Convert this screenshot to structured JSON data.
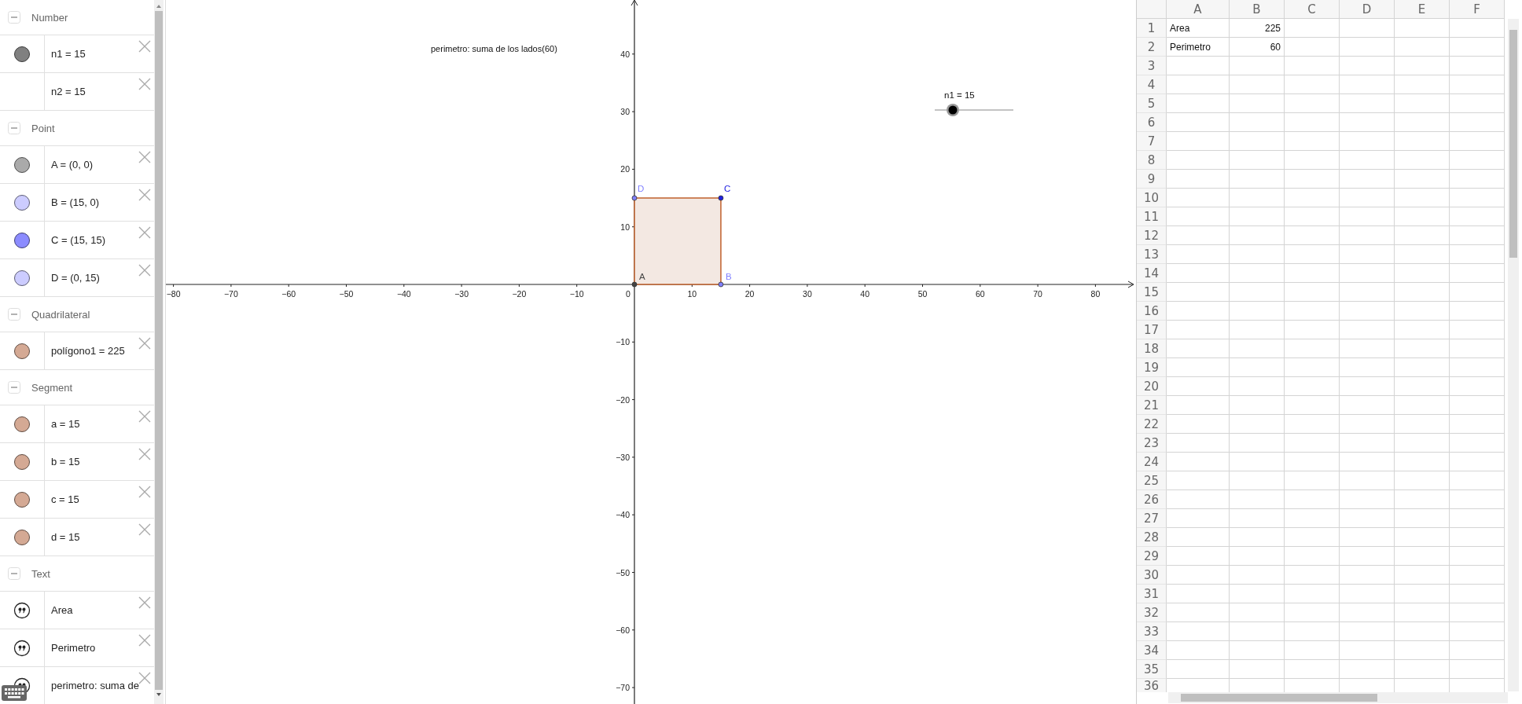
{
  "algebra": {
    "groups": [
      {
        "title": "Number",
        "expanded": true,
        "items": [
          {
            "kind": "dot",
            "color": "#808080",
            "text": "n1 = 15"
          },
          {
            "kind": "blank",
            "text": "n2 = 15"
          }
        ]
      },
      {
        "title": "Point",
        "expanded": true,
        "items": [
          {
            "kind": "dot",
            "color": "#aaaaaa",
            "text": "A = (0, 0)"
          },
          {
            "kind": "dot",
            "color": "#ccccff",
            "text": "B = (15, 0)"
          },
          {
            "kind": "dot",
            "color": "#8c8cff",
            "text": "C = (15, 15)"
          },
          {
            "kind": "dot",
            "color": "#ccccff",
            "text": "D = (0, 15)"
          }
        ]
      },
      {
        "title": "Quadrilateral",
        "expanded": true,
        "items": [
          {
            "kind": "dot",
            "color": "#d4a994",
            "text": "polígono1 = 225"
          }
        ]
      },
      {
        "title": "Segment",
        "expanded": true,
        "items": [
          {
            "kind": "dot",
            "color": "#d4a994",
            "text": "a = 15"
          },
          {
            "kind": "dot",
            "color": "#d4a994",
            "text": "b = 15"
          },
          {
            "kind": "dot",
            "color": "#d4a994",
            "text": "c = 15"
          },
          {
            "kind": "dot",
            "color": "#d4a994",
            "text": "d = 15"
          }
        ]
      },
      {
        "title": "Text",
        "expanded": true,
        "items": [
          {
            "kind": "quote",
            "text": "Area"
          },
          {
            "kind": "quote",
            "text": "Perimetro"
          },
          {
            "kind": "quote",
            "text": "perimetro: suma de"
          }
        ]
      }
    ]
  },
  "graphics": {
    "caption": "perimetro: suma de los lados(60)",
    "x_ticks": [
      "−80",
      "−70",
      "−60",
      "−50",
      "−40",
      "−30",
      "−20",
      "−10",
      "0",
      "10",
      "20",
      "30",
      "40",
      "50",
      "60",
      "70",
      "80"
    ],
    "y_ticks": [
      "40",
      "30",
      "20",
      "10",
      "−10",
      "−20",
      "−30",
      "−40",
      "−50",
      "−60",
      "−70"
    ],
    "points": [
      {
        "label": "D",
        "color": "#8080ff"
      },
      {
        "label": "C",
        "color": "#2020e0"
      },
      {
        "label": "A",
        "color": "#444444"
      },
      {
        "label": "B",
        "color": "#8080ff"
      }
    ],
    "slider": {
      "label": "n1 = 15",
      "level": 0.23
    }
  },
  "spreadsheet": {
    "columns": [
      "A",
      "B",
      "C",
      "D",
      "E",
      "F"
    ],
    "rows": [
      {
        "number": "1",
        "cells": [
          {
            "kind": "text",
            "text": "Area"
          },
          {
            "kind": "number",
            "text": "225"
          }
        ]
      },
      {
        "number": "2",
        "cells": [
          {
            "kind": "text",
            "text": "Perimetro"
          },
          {
            "kind": "number",
            "text": "60"
          }
        ]
      },
      {
        "number": "3"
      },
      {
        "number": "4"
      },
      {
        "number": "5"
      },
      {
        "number": "6"
      },
      {
        "number": "7"
      },
      {
        "number": "8"
      },
      {
        "number": "9"
      },
      {
        "number": "10"
      },
      {
        "number": "11"
      },
      {
        "number": "12"
      },
      {
        "number": "13"
      },
      {
        "number": "14"
      },
      {
        "number": "15"
      },
      {
        "number": "16"
      },
      {
        "number": "17"
      },
      {
        "number": "18"
      },
      {
        "number": "19"
      },
      {
        "number": "20"
      },
      {
        "number": "21"
      },
      {
        "number": "22"
      },
      {
        "number": "23"
      },
      {
        "number": "24"
      },
      {
        "number": "25"
      },
      {
        "number": "26"
      },
      {
        "number": "27"
      },
      {
        "number": "28"
      },
      {
        "number": "29"
      },
      {
        "number": "30"
      },
      {
        "number": "31"
      },
      {
        "number": "32"
      },
      {
        "number": "33"
      },
      {
        "number": "34"
      },
      {
        "number": "35"
      },
      {
        "number": "36"
      }
    ]
  }
}
